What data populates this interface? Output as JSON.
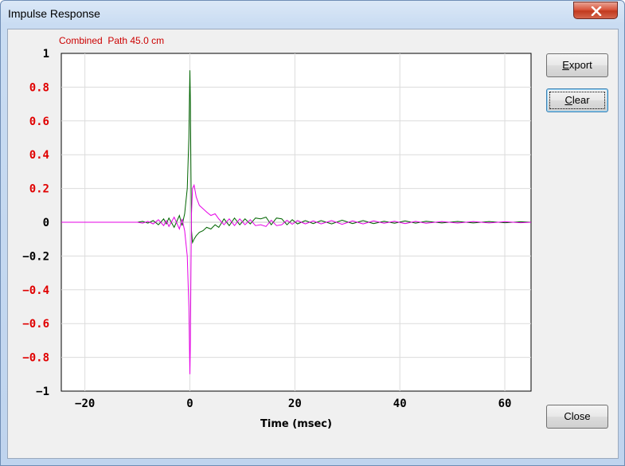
{
  "window": {
    "title": "Impulse Response"
  },
  "buttons": {
    "export": {
      "pre": "",
      "u": "E",
      "post": "xport"
    },
    "clear": {
      "pre": "",
      "u": "C",
      "post": "lear"
    },
    "close": {
      "label": "Close"
    }
  },
  "colors": {
    "title_red": "#cc0000",
    "axis_red": "#e00000",
    "series_green": "#006400",
    "series_magenta": "#e600e6",
    "grid": "#dcdcdc"
  },
  "chart_data": {
    "type": "line",
    "title": "Combined  Path 45.0 cm",
    "xlabel": "Time (msec)",
    "ylabel": "",
    "xlim": [
      -24.5,
      65
    ],
    "ylim": [
      -1,
      1
    ],
    "x_ticks": [
      -20,
      0,
      20,
      40,
      60
    ],
    "y_ticks": [
      {
        "value": 1,
        "label": "1",
        "color": "black"
      },
      {
        "value": 0.8,
        "label": "0.8",
        "color": "red"
      },
      {
        "value": 0.6,
        "label": "0.6",
        "color": "red"
      },
      {
        "value": 0.4,
        "label": "0.4",
        "color": "red"
      },
      {
        "value": 0.2,
        "label": "0.2",
        "color": "red"
      },
      {
        "value": 0,
        "label": "0",
        "color": "black"
      },
      {
        "value": -0.2,
        "label": "−0.2",
        "color": "black"
      },
      {
        "value": -0.4,
        "label": "−0.4",
        "color": "red"
      },
      {
        "value": -0.6,
        "label": "−0.6",
        "color": "red"
      },
      {
        "value": -0.8,
        "label": "−0.8",
        "color": "red"
      },
      {
        "value": -1,
        "label": "−1",
        "color": "black"
      }
    ],
    "grid": true,
    "series": [
      {
        "color": "#006400",
        "x": [
          -24.5,
          -10,
          -9,
          -8,
          -7,
          -6,
          -5,
          -4.5,
          -4,
          -3,
          -2,
          -1.5,
          -1,
          -0.5,
          -0.2,
          0,
          0.1,
          0.2,
          0.3,
          0.5,
          0.8,
          1.2,
          1.8,
          2.5,
          3.2,
          4,
          4.8,
          5.5,
          6.5,
          7.5,
          8.5,
          9.5,
          10.5,
          11.5,
          12.5,
          13.5,
          14.5,
          15.5,
          16.5,
          17.5,
          18.5,
          19.5,
          20.5,
          22,
          23.5,
          25,
          27,
          29,
          31,
          33,
          35,
          37,
          39,
          41,
          43,
          45,
          48,
          51,
          54,
          57,
          60,
          63,
          65
        ],
        "y": [
          0,
          0,
          0.005,
          -0.005,
          0.01,
          -0.015,
          0.02,
          -0.01,
          0.025,
          -0.03,
          0.04,
          -0.02,
          0.05,
          0.2,
          0.5,
          0.9,
          0.7,
          0.3,
          -0.05,
          -0.12,
          -0.1,
          -0.08,
          -0.06,
          -0.05,
          -0.03,
          -0.04,
          -0.015,
          -0.03,
          0.02,
          -0.02,
          0.025,
          -0.015,
          0.02,
          -0.01,
          0.025,
          0.02,
          0.03,
          -0.015,
          0.025,
          0.02,
          -0.015,
          0.015,
          -0.01,
          0.01,
          -0.008,
          0.01,
          -0.01,
          0.012,
          -0.008,
          0.01,
          -0.008,
          0.006,
          -0.006,
          0.008,
          -0.005,
          0.006,
          -0.004,
          0.005,
          -0.004,
          0.004,
          -0.003,
          0.003,
          0
        ]
      },
      {
        "color": "#e600e6",
        "x": [
          -24.5,
          -10,
          -9,
          -8,
          -7,
          -6,
          -5,
          -4.5,
          -4,
          -3,
          -2,
          -1.5,
          -1,
          -0.5,
          -0.2,
          0,
          0.1,
          0.2,
          0.3,
          0.5,
          0.8,
          1.2,
          1.8,
          2.5,
          3.2,
          4,
          4.8,
          5.5,
          6.5,
          7.5,
          8.5,
          9.5,
          10.5,
          11.5,
          12.5,
          13.5,
          14.5,
          15.5,
          16.5,
          17.5,
          18.5,
          19.5,
          20.5,
          22,
          23.5,
          25,
          27,
          29,
          31,
          33,
          35,
          37,
          39,
          41,
          43,
          45,
          48,
          51,
          54,
          57,
          60,
          63,
          65
        ],
        "y": [
          0,
          0,
          -0.005,
          0.005,
          -0.01,
          0.015,
          -0.02,
          0.01,
          -0.025,
          0.03,
          -0.04,
          0.02,
          -0.05,
          -0.2,
          -0.5,
          -0.9,
          -0.7,
          -0.3,
          0.05,
          0.2,
          0.22,
          0.15,
          0.1,
          0.08,
          0.06,
          0.04,
          0.05,
          0.02,
          -0.015,
          0.02,
          -0.02,
          0.02,
          -0.015,
          0.015,
          -0.02,
          -0.015,
          -0.025,
          0.012,
          -0.02,
          -0.015,
          0.012,
          -0.012,
          0.01,
          -0.01,
          0.008,
          -0.01,
          0.01,
          -0.012,
          0.008,
          -0.01,
          0.008,
          -0.006,
          0.006,
          -0.008,
          0.005,
          -0.006,
          0.004,
          -0.005,
          0.004,
          -0.004,
          0.003,
          -0.003,
          0
        ]
      }
    ]
  }
}
